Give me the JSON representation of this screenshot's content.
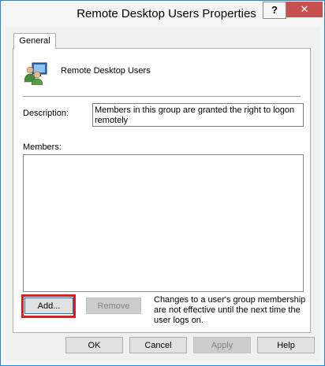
{
  "window": {
    "title": "Remote Desktop Users Properties",
    "help_label": "?",
    "close_label": "✕"
  },
  "tabs": [
    {
      "label": "General",
      "selected": true
    }
  ],
  "group": {
    "icon": "users-group-icon",
    "name": "Remote Desktop Users"
  },
  "description": {
    "label": "Description:",
    "value": "Members in this group are granted the right to logon remotely"
  },
  "members": {
    "label": "Members:",
    "items": []
  },
  "buttons": {
    "add": "Add...",
    "remove": "Remove",
    "ok": "OK",
    "cancel": "Cancel",
    "apply": "Apply",
    "help": "Help"
  },
  "note": "Changes to a user's group membership are not effective until the next time the user logs on.",
  "colors": {
    "accent": "#1c8ad7",
    "close_red": "#c75050",
    "highlight_red": "#e21b1b"
  }
}
